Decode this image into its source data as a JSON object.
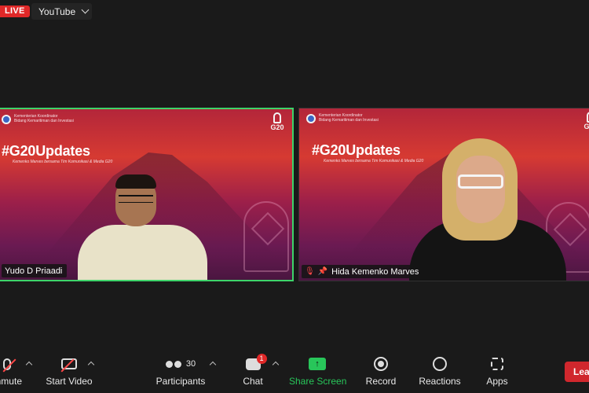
{
  "topbar": {
    "live_label": "LIVE",
    "stream_target": "YouTube"
  },
  "tiles": [
    {
      "org_line1": "Kementerian Koordinator",
      "org_line2": "Bidang Kemaritiman dan Investasi",
      "g20_text": "G20",
      "hashtag": "#G20Updates",
      "subtitle": "Kemenko Marves bersama Tim Komunikasi & Media G20",
      "participant_name": "Yudo D Priaadi",
      "active_speaker": true
    },
    {
      "org_line1": "Kementerian Koordinator",
      "org_line2": "Bidang Kemaritiman dan Investasi",
      "g20_text": "G20",
      "hashtag": "#G20Updates",
      "subtitle": "Kemenko Marves bersama Tim Komunikasi & Media G20",
      "participant_name": "Hida Kemenko Marves",
      "muted": true,
      "pinned": true
    }
  ],
  "toolbar": {
    "unmute_label": "Unmute",
    "start_video_label": "Start Video",
    "participants_label": "Participants",
    "participants_count": "30",
    "chat_label": "Chat",
    "chat_badge": "1",
    "share_label": "Share Screen",
    "record_label": "Record",
    "reactions_label": "Reactions",
    "apps_label": "Apps",
    "leave_label": "Leave"
  },
  "colors": {
    "live": "#e02828",
    "active_border": "#3dd46a",
    "share": "#28c65a",
    "leave": "#d0272d"
  }
}
